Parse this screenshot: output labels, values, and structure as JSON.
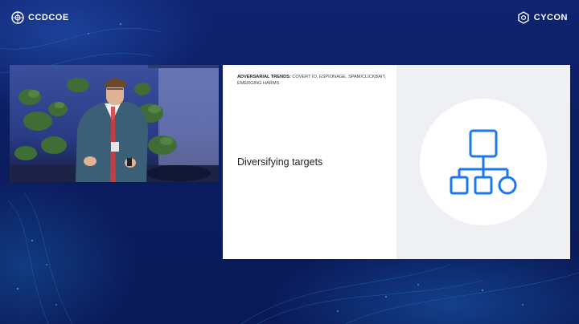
{
  "branding": {
    "left_logo": "CCDCOE",
    "right_logo": "CYCON"
  },
  "slide": {
    "eyebrow_bold": "ADVERSARIAL TRENDS:",
    "eyebrow_rest": " COVERT IO, ESPIONAGE, SPAM/CLICKBAIT, EMERGING HARMS",
    "title": "Diversifying targets",
    "icon": "org-chart-icon",
    "icon_color": "#1877f2"
  },
  "colors": {
    "background": "#0d1f63",
    "slide_panel": "#eef0f3"
  }
}
